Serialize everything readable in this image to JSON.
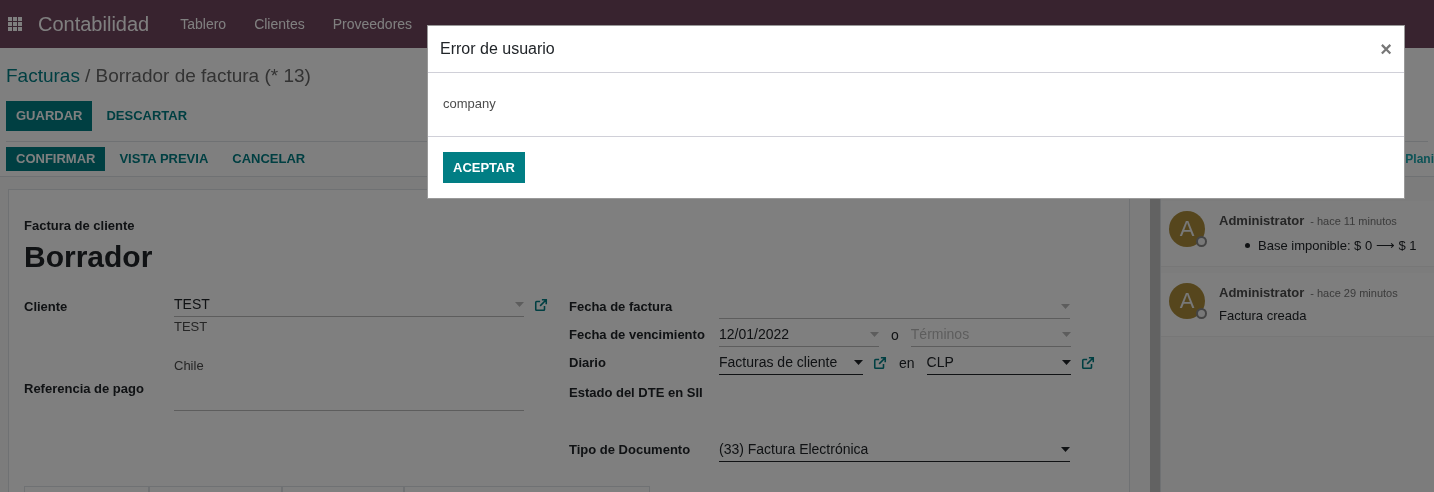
{
  "navbar": {
    "app": "Contabilidad",
    "menu": [
      "Tablero",
      "Clientes",
      "Proveedores"
    ]
  },
  "breadcrumb": {
    "parent": "Facturas",
    "current": "/ Borrador de factura (* 13)"
  },
  "edit_buttons": [
    {
      "label": "GUARDAR",
      "primary": true
    },
    {
      "label": "DESCARTAR",
      "primary": false
    }
  ],
  "status_buttons": [
    {
      "label": "CONFIRMAR",
      "primary": true
    },
    {
      "label": "VISTA PREVIA",
      "primary": false
    },
    {
      "label": "CANCELAR",
      "primary": false
    }
  ],
  "chatter_action": "Plani",
  "form": {
    "subtitle": "Factura de cliente",
    "title": "Borrador",
    "left_fields": [
      {
        "label": "Cliente",
        "kind": "select",
        "value": "TEST",
        "required": false,
        "link": true,
        "address": [
          "TEST",
          "Chile"
        ]
      },
      {
        "label": "Referencia de pago",
        "kind": "text"
      }
    ],
    "right_fields": [
      {
        "label": "Fecha de factura",
        "kind": "select",
        "required": false,
        "link": false
      },
      {
        "label": "Fecha de vencimiento",
        "kind": "select",
        "value": "12/01/2022",
        "required": false,
        "link": false,
        "joiner": "o",
        "second": {
          "placeholder": "Términos",
          "required": false,
          "link": false
        }
      },
      {
        "label": "Diario",
        "kind": "select",
        "value": "Facturas de cliente",
        "required": true,
        "link": true,
        "joiner": "en",
        "second": {
          "value": "CLP",
          "required": true,
          "link": true
        }
      },
      {
        "label": "Estado del DTE en SII",
        "kind": "readonly"
      },
      {
        "label": "Tipo de Documento",
        "kind": "select",
        "value": "(33) Factura Electrónica",
        "required": true,
        "link": false
      }
    ]
  },
  "chatter": [
    {
      "initial": "A",
      "author": "Administrator",
      "time": "- hace 11 minutos",
      "bullets": [
        "Base imponible: $ 0 ⟶ $ 1"
      ]
    },
    {
      "initial": "A",
      "author": "Administrator",
      "time": "- hace 29 minutos",
      "body": "Factura creada"
    }
  ],
  "dialog": {
    "title": "Error de usuario",
    "close": "×",
    "message": "company",
    "button": "ACEPTAR"
  }
}
